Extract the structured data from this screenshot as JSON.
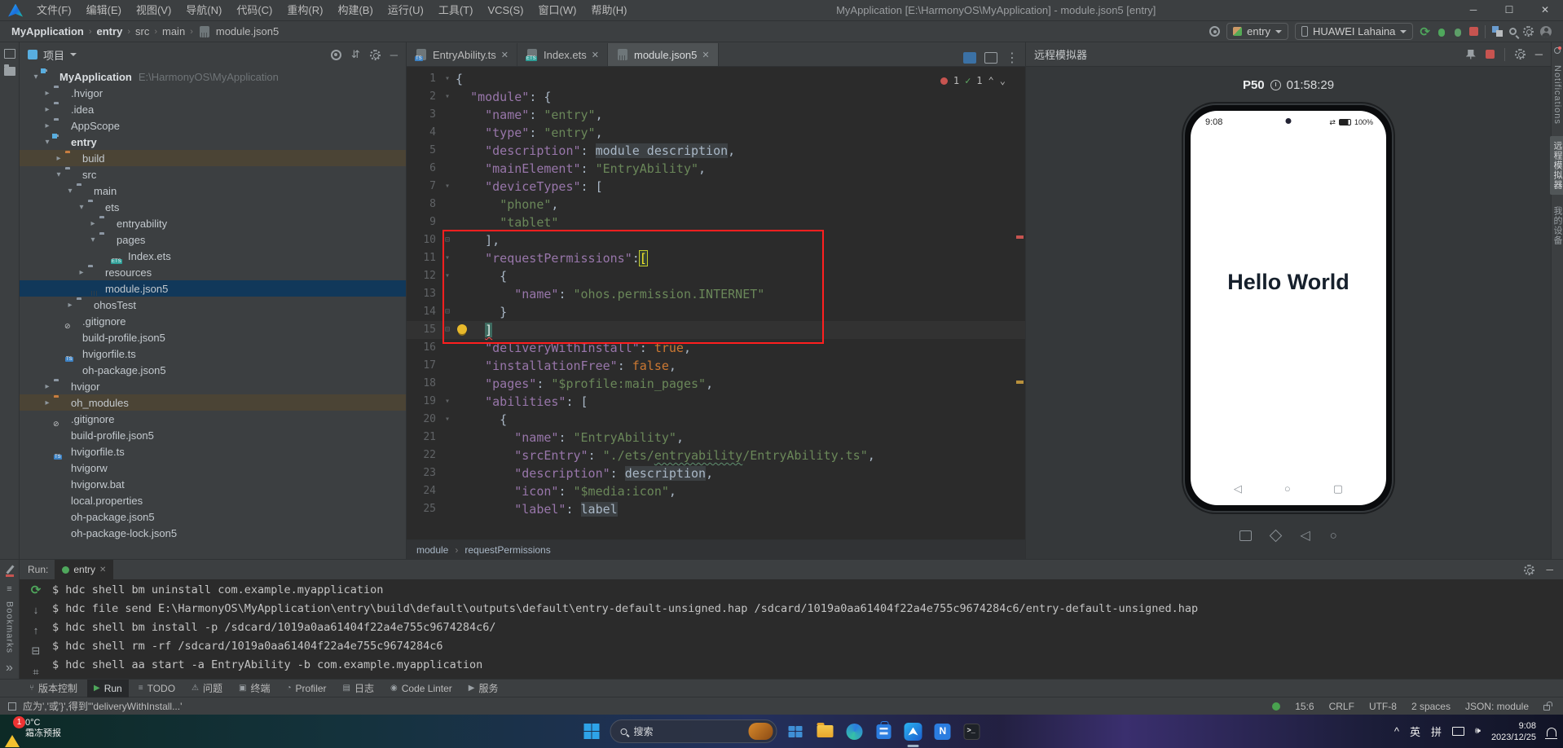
{
  "title_bar": {
    "menus": [
      "文件(F)",
      "编辑(E)",
      "视图(V)",
      "导航(N)",
      "代码(C)",
      "重构(R)",
      "构建(B)",
      "运行(U)",
      "工具(T)",
      "VCS(S)",
      "窗口(W)",
      "帮助(H)"
    ],
    "title": "MyApplication [E:\\HarmonyOS\\MyApplication] - module.json5 [entry]",
    "controls": {
      "minimize": "─",
      "maximize": "☐",
      "close": "✕"
    }
  },
  "toolbar": {
    "breadcrumbs": [
      "MyApplication",
      "entry",
      "src",
      "main",
      "module.json5"
    ],
    "run_config": "entry",
    "device": "HUAWEI Lahaina"
  },
  "project": {
    "header": "项目",
    "tree": [
      {
        "i": 0,
        "a": "v",
        "ic": "mod",
        "label": "MyApplication",
        "bold": true,
        "path": "E:\\HarmonyOS\\MyApplication",
        "hl": ""
      },
      {
        "i": 1,
        "a": ">",
        "ic": "f",
        "label": ".hvigor",
        "hl": ""
      },
      {
        "i": 1,
        "a": ">",
        "ic": "f",
        "label": ".idea",
        "hl": ""
      },
      {
        "i": 1,
        "a": ">",
        "ic": "f",
        "label": "AppScope",
        "hl": ""
      },
      {
        "i": 1,
        "a": "v",
        "ic": "mod",
        "label": "entry",
        "bold": true,
        "hl": ""
      },
      {
        "i": 2,
        "a": ">",
        "ic": "fo",
        "label": "build",
        "hl": "warm"
      },
      {
        "i": 2,
        "a": "v",
        "ic": "f",
        "label": "src",
        "hl": ""
      },
      {
        "i": 3,
        "a": "v",
        "ic": "f",
        "label": "main",
        "hl": ""
      },
      {
        "i": 4,
        "a": "v",
        "ic": "f",
        "label": "ets",
        "hl": ""
      },
      {
        "i": 5,
        "a": ">",
        "ic": "f",
        "label": "entryability",
        "hl": ""
      },
      {
        "i": 5,
        "a": "v",
        "ic": "f",
        "label": "pages",
        "hl": ""
      },
      {
        "i": 6,
        "a": "",
        "ic": "ets",
        "label": "Index.ets",
        "hl": ""
      },
      {
        "i": 4,
        "a": ">",
        "ic": "f",
        "label": "resources",
        "hl": ""
      },
      {
        "i": 4,
        "a": "",
        "ic": "j5",
        "label": "module.json5",
        "hl": "sel"
      },
      {
        "i": 3,
        "a": ">",
        "ic": "f",
        "label": "ohosTest",
        "hl": ""
      },
      {
        "i": 2,
        "a": "",
        "ic": "git",
        "label": ".gitignore",
        "hl": ""
      },
      {
        "i": 2,
        "a": "",
        "ic": "j5",
        "label": "build-profile.json5",
        "hl": ""
      },
      {
        "i": 2,
        "a": "",
        "ic": "ts",
        "label": "hvigorfile.ts",
        "hl": ""
      },
      {
        "i": 2,
        "a": "",
        "ic": "j5",
        "label": "oh-package.json5",
        "hl": ""
      },
      {
        "i": 1,
        "a": ">",
        "ic": "f",
        "label": "hvigor",
        "hl": ""
      },
      {
        "i": 1,
        "a": ">",
        "ic": "fo",
        "label": "oh_modules",
        "hl": "warm"
      },
      {
        "i": 1,
        "a": "",
        "ic": "git",
        "label": ".gitignore",
        "hl": ""
      },
      {
        "i": 1,
        "a": "",
        "ic": "j5",
        "label": "build-profile.json5",
        "hl": ""
      },
      {
        "i": 1,
        "a": "",
        "ic": "ts",
        "label": "hvigorfile.ts",
        "hl": ""
      },
      {
        "i": 1,
        "a": "",
        "ic": "file",
        "label": "hvigorw",
        "hl": ""
      },
      {
        "i": 1,
        "a": "",
        "ic": "file",
        "label": "hvigorw.bat",
        "hl": ""
      },
      {
        "i": 1,
        "a": "",
        "ic": "file",
        "label": "local.properties",
        "hl": ""
      },
      {
        "i": 1,
        "a": "",
        "ic": "j5",
        "label": "oh-package.json5",
        "hl": ""
      },
      {
        "i": 1,
        "a": "",
        "ic": "j5",
        "label": "oh-package-lock.json5",
        "hl": ""
      }
    ]
  },
  "tabs": [
    {
      "label": "EntryAbility.ts",
      "kind": "ts",
      "active": false
    },
    {
      "label": "Index.ets",
      "kind": "ets",
      "active": false
    },
    {
      "label": "module.json5",
      "kind": "j5",
      "active": true
    }
  ],
  "editor": {
    "inspections": {
      "errors": "1",
      "ok": "1"
    },
    "breadcrumb": [
      "module",
      "requestPermissions"
    ],
    "lines": [
      {
        "n": "1",
        "fold": "v",
        "segs": [
          [
            "{",
            "p"
          ]
        ]
      },
      {
        "n": "2",
        "fold": "v",
        "segs": [
          [
            "  ",
            "p"
          ],
          [
            "\"module\"",
            "k"
          ],
          [
            ": {",
            "p"
          ]
        ]
      },
      {
        "n": "3",
        "fold": "",
        "segs": [
          [
            "    ",
            "p"
          ],
          [
            "\"name\"",
            "k"
          ],
          [
            ": ",
            "p"
          ],
          [
            "\"entry\"",
            "s"
          ],
          [
            ",",
            "p"
          ]
        ]
      },
      {
        "n": "4",
        "fold": "",
        "segs": [
          [
            "    ",
            "p"
          ],
          [
            "\"type\"",
            "k"
          ],
          [
            ": ",
            "p"
          ],
          [
            "\"entry\"",
            "s"
          ],
          [
            ",",
            "p"
          ]
        ]
      },
      {
        "n": "5",
        "fold": "",
        "segs": [
          [
            "    ",
            "p"
          ],
          [
            "\"description\"",
            "k"
          ],
          [
            ": ",
            "p"
          ],
          [
            "module description",
            "hint"
          ],
          [
            ",",
            "p"
          ]
        ]
      },
      {
        "n": "6",
        "fold": "",
        "segs": [
          [
            "    ",
            "p"
          ],
          [
            "\"mainElement\"",
            "k"
          ],
          [
            ": ",
            "p"
          ],
          [
            "\"EntryAbility\"",
            "s"
          ],
          [
            ",",
            "p"
          ]
        ]
      },
      {
        "n": "7",
        "fold": "v",
        "segs": [
          [
            "    ",
            "p"
          ],
          [
            "\"deviceTypes\"",
            "k"
          ],
          [
            ": [",
            "p"
          ]
        ]
      },
      {
        "n": "8",
        "fold": "",
        "segs": [
          [
            "      ",
            "p"
          ],
          [
            "\"phone\"",
            "s"
          ],
          [
            ",",
            "p"
          ]
        ]
      },
      {
        "n": "9",
        "fold": "",
        "segs": [
          [
            "      ",
            "p"
          ],
          [
            "\"tablet\"",
            "s"
          ]
        ]
      },
      {
        "n": "10",
        "fold": "m",
        "segs": [
          [
            "    ],",
            "p"
          ]
        ]
      },
      {
        "n": "11",
        "fold": "v",
        "segs": [
          [
            "    ",
            "p"
          ],
          [
            "\"requestPermissions\"",
            "k"
          ],
          [
            ":",
            "p"
          ],
          [
            "[",
            "brkt"
          ]
        ]
      },
      {
        "n": "12",
        "fold": "v",
        "segs": [
          [
            "      {",
            "p"
          ]
        ]
      },
      {
        "n": "13",
        "fold": "",
        "segs": [
          [
            "        ",
            "p"
          ],
          [
            "\"name\"",
            "k"
          ],
          [
            ": ",
            "p"
          ],
          [
            "\"ohos.permission.INTERNET\"",
            "s"
          ]
        ]
      },
      {
        "n": "14",
        "fold": "m",
        "segs": [
          [
            "      }",
            "p"
          ]
        ]
      },
      {
        "n": "15",
        "fold": "m",
        "cur": true,
        "bulb": true,
        "segs": [
          [
            "    ",
            "p"
          ],
          [
            "]",
            "match"
          ]
        ]
      },
      {
        "n": "16",
        "fold": "",
        "segs": [
          [
            "    ",
            "p"
          ],
          [
            "\"deliveryWithInstall\"",
            "k"
          ],
          [
            ": ",
            "p"
          ],
          [
            "true",
            "b"
          ],
          [
            ",",
            "p"
          ]
        ]
      },
      {
        "n": "17",
        "fold": "",
        "segs": [
          [
            "    ",
            "p"
          ],
          [
            "\"installationFree\"",
            "k"
          ],
          [
            ": ",
            "p"
          ],
          [
            "false",
            "b"
          ],
          [
            ",",
            "p"
          ]
        ]
      },
      {
        "n": "18",
        "fold": "",
        "segs": [
          [
            "    ",
            "p"
          ],
          [
            "\"pages\"",
            "k"
          ],
          [
            ": ",
            "p"
          ],
          [
            "\"$profile:main_pages\"",
            "s"
          ],
          [
            ",",
            "p"
          ]
        ]
      },
      {
        "n": "19",
        "fold": "v",
        "segs": [
          [
            "    ",
            "p"
          ],
          [
            "\"abilities\"",
            "k"
          ],
          [
            ": [",
            "p"
          ]
        ]
      },
      {
        "n": "20",
        "fold": "v",
        "segs": [
          [
            "      {",
            "p"
          ]
        ]
      },
      {
        "n": "21",
        "fold": "",
        "segs": [
          [
            "        ",
            "p"
          ],
          [
            "\"name\"",
            "k"
          ],
          [
            ": ",
            "p"
          ],
          [
            "\"EntryAbility\"",
            "s"
          ],
          [
            ",",
            "p"
          ]
        ]
      },
      {
        "n": "22",
        "fold": "",
        "segs": [
          [
            "        ",
            "p"
          ],
          [
            "\"srcEntry\"",
            "k"
          ],
          [
            ": ",
            "p"
          ],
          [
            "\"./ets/",
            "s"
          ],
          [
            "entryability",
            "sWavy"
          ],
          [
            "/EntryAbility.ts\"",
            "s"
          ],
          [
            ",",
            "p"
          ]
        ]
      },
      {
        "n": "23",
        "fold": "",
        "segs": [
          [
            "        ",
            "p"
          ],
          [
            "\"description\"",
            "k"
          ],
          [
            ": ",
            "p"
          ],
          [
            "description",
            "hint"
          ],
          [
            ",",
            "p"
          ]
        ]
      },
      {
        "n": "24",
        "fold": "",
        "segs": [
          [
            "        ",
            "p"
          ],
          [
            "\"icon\"",
            "k"
          ],
          [
            ": ",
            "p"
          ],
          [
            "\"$media:icon\"",
            "s"
          ],
          [
            ",",
            "p"
          ]
        ]
      },
      {
        "n": "25",
        "fold": "",
        "segs": [
          [
            "        ",
            "p"
          ],
          [
            "\"label\"",
            "k"
          ],
          [
            ": ",
            "p"
          ],
          [
            "label",
            "hint"
          ]
        ]
      }
    ]
  },
  "emulator": {
    "panel_title": "远程模拟器",
    "device_name": "P50",
    "uptime": "01:58:29",
    "phone": {
      "status_time": "9:08",
      "battery": "100%",
      "greeting": "Hello World"
    }
  },
  "right_strip": {
    "notifications": "Notifications",
    "tab_emulator": "远程模拟器",
    "tab_devices": "我的设备"
  },
  "run": {
    "label": "Run:",
    "tab": "entry",
    "terminal_lines": [
      "$ hdc shell bm uninstall com.example.myapplication",
      "$ hdc file send E:\\HarmonyOS\\MyApplication\\entry\\build\\default\\outputs\\default\\entry-default-unsigned.hap /sdcard/1019a0aa61404f22a4e755c9674284c6/entry-default-unsigned.hap",
      "$ hdc shell bm install -p /sdcard/1019a0aa61404f22a4e755c9674284c6/",
      "$ hdc shell rm -rf /sdcard/1019a0aa61404f22a4e755c9674284c6",
      "$ hdc shell aa start -a EntryAbility -b com.example.myapplication"
    ]
  },
  "toolwindow_bar": {
    "items": [
      {
        "label": "版本控制",
        "icon": "branch",
        "active": false
      },
      {
        "label": "Run",
        "icon": "run",
        "active": true
      },
      {
        "label": "TODO",
        "icon": "todo",
        "active": false
      },
      {
        "label": "问题",
        "icon": "problems",
        "active": false
      },
      {
        "label": "终端",
        "icon": "terminal",
        "active": false
      },
      {
        "label": "Profiler",
        "icon": "profiler",
        "active": false
      },
      {
        "label": "日志",
        "icon": "log",
        "active": false
      },
      {
        "label": "Code Linter",
        "icon": "linter",
        "active": false
      },
      {
        "label": "服务",
        "icon": "services",
        "active": false
      }
    ]
  },
  "status_bar": {
    "message": "应为','或'}',得到'\"deliveryWithInstall...'",
    "position": "15:6",
    "line_sep": "CRLF",
    "encoding": "UTF-8",
    "indent": "2 spaces",
    "file_type": "JSON: module"
  },
  "taskbar": {
    "weather": {
      "badge": "1",
      "temp": "0°C",
      "text": "霜冻预报"
    },
    "search_placeholder": "搜索",
    "tray": {
      "lang1": "英",
      "lang2": "拼",
      "time": "9:08",
      "date": "2023/12/25",
      "chevron": "^"
    }
  },
  "colors": {
    "accent_blue": "#2bb3f0",
    "error_red": "#c75450",
    "ok_green": "#4fa75c",
    "annotation_red": "#ff1f1f"
  }
}
